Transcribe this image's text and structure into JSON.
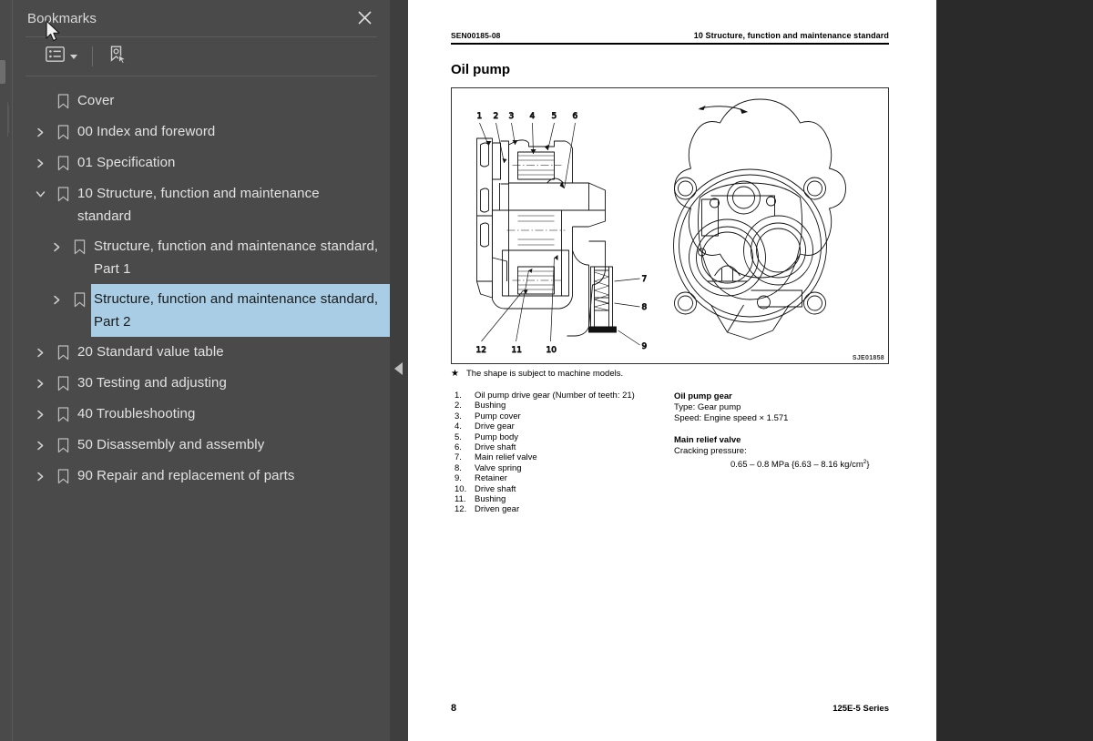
{
  "sidebar": {
    "title": "Bookmarks",
    "close_icon": "close-icon",
    "toolbar": {
      "options_icon": "list-options-icon",
      "options_caret": "chevron-down-icon",
      "new_bookmark_icon": "new-bookmark-icon"
    },
    "collapse_icon": "collapse-panel-triangle-icon",
    "items": [
      {
        "label": "Cover",
        "level": 1,
        "twisty": "none",
        "selected": false
      },
      {
        "label": "00 Index and foreword",
        "level": 1,
        "twisty": "collapsed",
        "selected": false
      },
      {
        "label": "01 Specification",
        "level": 1,
        "twisty": "collapsed",
        "selected": false
      },
      {
        "label": "10 Structure, function and maintenance standard",
        "level": 1,
        "twisty": "expanded",
        "selected": false
      },
      {
        "label": "Structure, function and maintenance standard, Part 1",
        "level": 2,
        "twisty": "collapsed",
        "selected": false
      },
      {
        "label": "Structure, function and maintenance standard, Part 2",
        "level": 2,
        "twisty": "collapsed",
        "selected": true
      },
      {
        "label": "20 Standard value table",
        "level": 1,
        "twisty": "collapsed",
        "selected": false
      },
      {
        "label": "30 Testing and adjusting",
        "level": 1,
        "twisty": "collapsed",
        "selected": false
      },
      {
        "label": "40 Troubleshooting",
        "level": 1,
        "twisty": "collapsed",
        "selected": false
      },
      {
        "label": "50 Disassembly and assembly",
        "level": 1,
        "twisty": "collapsed",
        "selected": false
      },
      {
        "label": "90 Repair and replacement of parts",
        "level": 1,
        "twisty": "collapsed",
        "selected": false
      }
    ],
    "colors": {
      "panel": "#4a4a4a",
      "selection": "#a8cde4",
      "text": "#e2e2e2"
    }
  },
  "document": {
    "header_left": "SEN00185-08",
    "header_right": "10 Structure, function and maintenance standard",
    "title": "Oil pump",
    "figure_code": "SJE01858",
    "note_marker": "★",
    "note": "The shape is subject to machine models.",
    "parts": [
      {
        "num": "1.",
        "name": "Oil pump drive gear (Number of teeth: 21)"
      },
      {
        "num": "2.",
        "name": "Bushing"
      },
      {
        "num": "3.",
        "name": "Pump cover"
      },
      {
        "num": "4.",
        "name": "Drive gear"
      },
      {
        "num": "5.",
        "name": "Pump body"
      },
      {
        "num": "6.",
        "name": "Drive shaft"
      },
      {
        "num": "7.",
        "name": "Main relief valve"
      },
      {
        "num": "8.",
        "name": "Valve spring"
      },
      {
        "num": "9.",
        "name": "Retainer"
      },
      {
        "num": "10.",
        "name": "Drive shaft"
      },
      {
        "num": "11.",
        "name": "Bushing"
      },
      {
        "num": "12.",
        "name": "Driven gear"
      }
    ],
    "specs": {
      "gear_heading": "Oil pump gear",
      "gear_type": "Type:    Gear pump",
      "gear_speed": "Speed: Engine speed × 1.571",
      "valve_heading": "Main relief valve",
      "valve_label": "Cracking pressure:",
      "valve_value": "0.65 – 0.8 MPa {6.63 – 8.16 kg/cm",
      "valve_value_sup": "2",
      "valve_value_end": "}"
    },
    "callouts_top": [
      "1",
      "2",
      "3",
      "4",
      "5",
      "6"
    ],
    "callouts_right": [
      "7",
      "8",
      "9"
    ],
    "callouts_bottom": [
      "12",
      "11",
      "10",
      "9"
    ],
    "footer_page": "8",
    "footer_right": "125E-5 Series"
  },
  "cursor": {
    "icon": "mouse-pointer-icon"
  }
}
